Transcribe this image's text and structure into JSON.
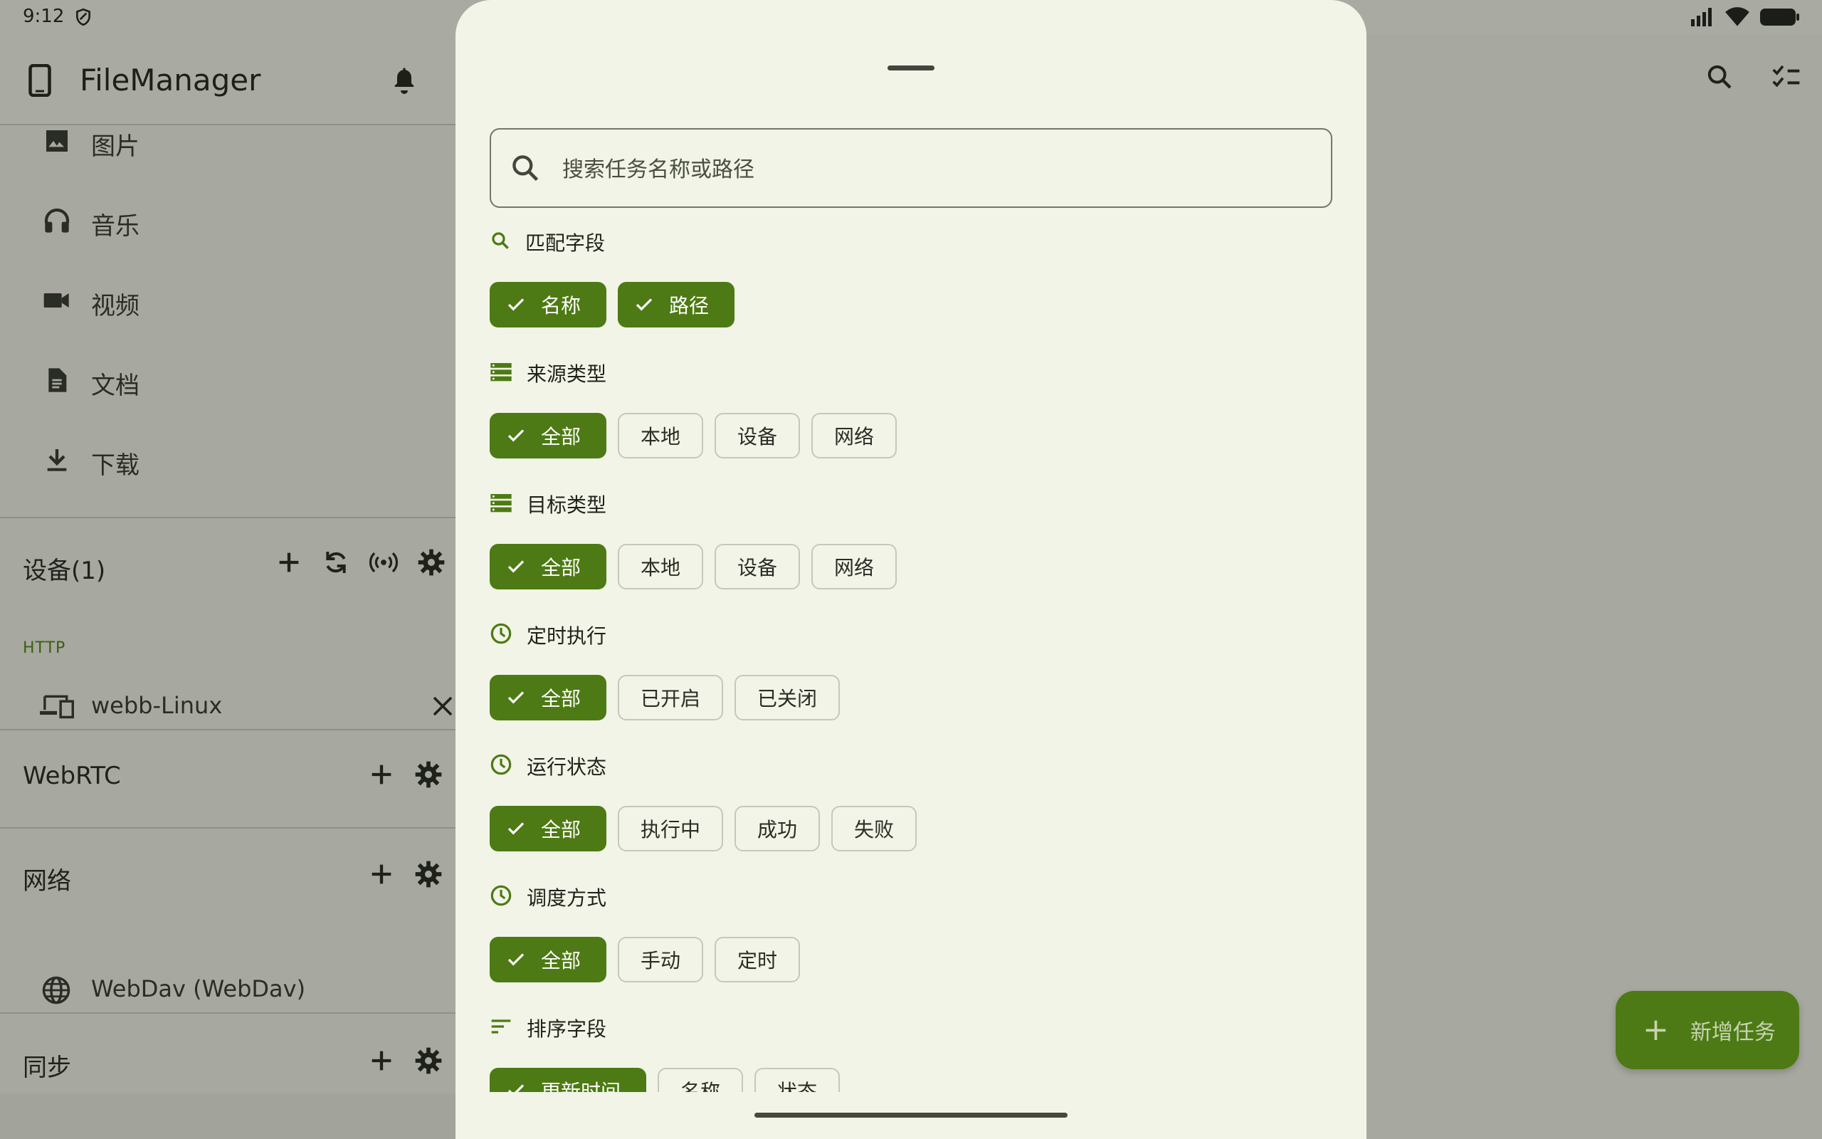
{
  "status": {
    "time": "9:12"
  },
  "app": {
    "title": "FileManager"
  },
  "nav": [
    {
      "label": "图片",
      "icon": "image-icon"
    },
    {
      "label": "音乐",
      "icon": "headphones-icon"
    },
    {
      "label": "视频",
      "icon": "videocam-icon"
    },
    {
      "label": "文档",
      "icon": "document-icon"
    },
    {
      "label": "下载",
      "icon": "download-icon"
    }
  ],
  "devices": {
    "title": "设备(1)",
    "protocol": "HTTP",
    "item": "webb-Linux"
  },
  "webrtc": {
    "title": "WebRTC"
  },
  "network": {
    "title": "网络",
    "item": "WebDav (WebDav)"
  },
  "sync": {
    "title": "同步"
  },
  "fab": {
    "label": "新增任务"
  },
  "sheet": {
    "search_placeholder": "搜索任务名称或路径",
    "groups": [
      {
        "title": "匹配字段",
        "icon": "search-icon",
        "chips": [
          {
            "label": "名称",
            "selected": true
          },
          {
            "label": "路径",
            "selected": true
          }
        ]
      },
      {
        "title": "来源类型",
        "icon": "storage-icon",
        "chips": [
          {
            "label": "全部",
            "selected": true
          },
          {
            "label": "本地",
            "selected": false
          },
          {
            "label": "设备",
            "selected": false
          },
          {
            "label": "网络",
            "selected": false
          }
        ]
      },
      {
        "title": "目标类型",
        "icon": "storage-icon",
        "chips": [
          {
            "label": "全部",
            "selected": true
          },
          {
            "label": "本地",
            "selected": false
          },
          {
            "label": "设备",
            "selected": false
          },
          {
            "label": "网络",
            "selected": false
          }
        ]
      },
      {
        "title": "定时执行",
        "icon": "clock-icon",
        "chips": [
          {
            "label": "全部",
            "selected": true
          },
          {
            "label": "已开启",
            "selected": false
          },
          {
            "label": "已关闭",
            "selected": false
          }
        ]
      },
      {
        "title": "运行状态",
        "icon": "clock-icon",
        "chips": [
          {
            "label": "全部",
            "selected": true
          },
          {
            "label": "执行中",
            "selected": false
          },
          {
            "label": "成功",
            "selected": false
          },
          {
            "label": "失败",
            "selected": false
          }
        ]
      },
      {
        "title": "调度方式",
        "icon": "clock-icon",
        "chips": [
          {
            "label": "全部",
            "selected": true
          },
          {
            "label": "手动",
            "selected": false
          },
          {
            "label": "定时",
            "selected": false
          }
        ]
      },
      {
        "title": "排序字段",
        "icon": "sort-icon",
        "chips": [
          {
            "label": "更新时间",
            "selected": true
          },
          {
            "label": "名称",
            "selected": false
          },
          {
            "label": "状态",
            "selected": false
          }
        ]
      }
    ]
  },
  "colors": {
    "accent": "#4d7a14",
    "sheet_bg": "#f1f4e6",
    "scrim": "#a7a8a0"
  }
}
